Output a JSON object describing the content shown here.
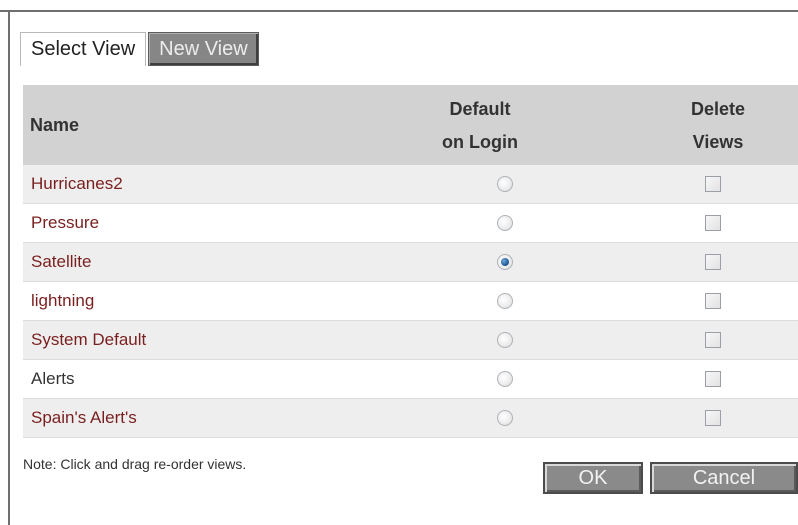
{
  "tabs": {
    "select_view": "Select View",
    "new_view": "New View"
  },
  "columns": {
    "name": "Name",
    "default_line1": "Default",
    "default_line2": "on Login",
    "delete_line1": "Delete",
    "delete_line2": "Views"
  },
  "views": [
    {
      "name": "Hurricanes2",
      "default_on_login": false,
      "delete": false
    },
    {
      "name": "Pressure",
      "default_on_login": false,
      "delete": false
    },
    {
      "name": "Satellite",
      "default_on_login": true,
      "delete": false
    },
    {
      "name": "lightning",
      "default_on_login": false,
      "delete": false
    },
    {
      "name": "System Default",
      "default_on_login": false,
      "delete": false
    },
    {
      "name": "Alerts",
      "default_on_login": false,
      "delete": false
    },
    {
      "name": "Spain's Alert's",
      "default_on_login": false,
      "delete": false
    }
  ],
  "footer": {
    "note": "Note: Click and drag re-order views.",
    "ok": "OK",
    "cancel": "Cancel"
  },
  "colors": {
    "header_bg": "#d2d2d2",
    "row_alt_bg": "#eeeeee",
    "link_text": "#7a1f1f",
    "button_bg": "#8a8a8a",
    "radio_selected": "#215f9a"
  }
}
